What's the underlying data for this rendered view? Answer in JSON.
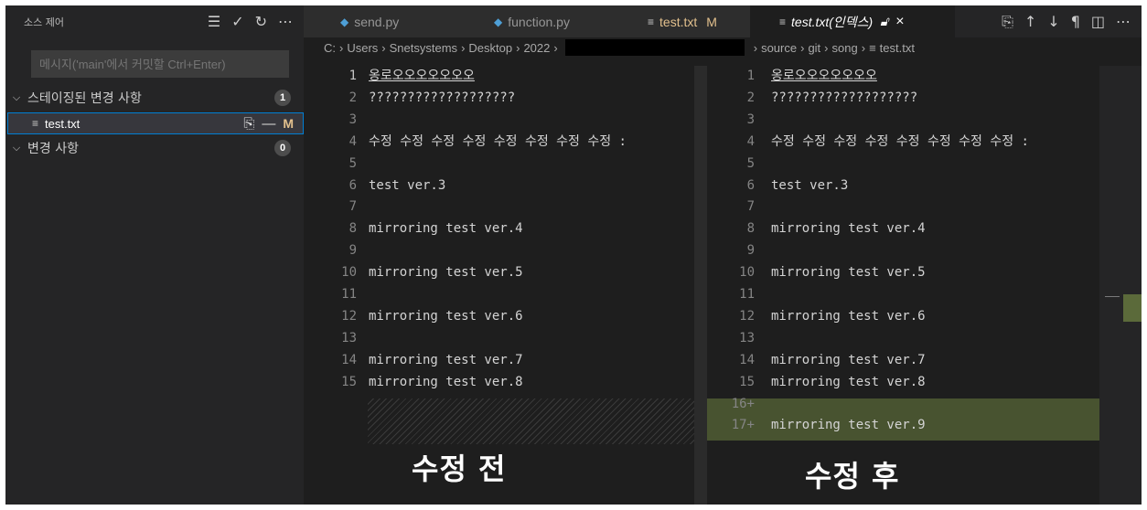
{
  "sidebar": {
    "title": "소스 제어",
    "actions": [
      "☰",
      "✓",
      "↻",
      "⋯"
    ],
    "commit_placeholder": "메시지('main'에서 커밋할 Ctrl+Enter)",
    "staged_group": {
      "label": "스테이징된 변경 사항",
      "count": "1"
    },
    "staged_file": {
      "name": "test.txt",
      "status": "M"
    },
    "changes_group": {
      "label": "변경 사항",
      "count": "0"
    }
  },
  "tabs": [
    {
      "label": "send.py",
      "icon": "python-icon"
    },
    {
      "label": "function.py",
      "icon": "python-icon"
    },
    {
      "label": "test.txt",
      "mark": "M",
      "icon": "file-text-icon"
    },
    {
      "label": "test.txt(인덱스)",
      "icon": "file-text-icon",
      "active": true
    }
  ],
  "breadcrumb": {
    "left": [
      "C:",
      "Users",
      "Snetsystems",
      "Desktop",
      "2022"
    ],
    "right": [
      "source",
      "git",
      "song",
      "test.txt"
    ]
  },
  "left_pane": {
    "lines": [
      {
        "n": "1",
        "text": "옹로오오오오오오오"
      },
      {
        "n": "2",
        "text": "???????????????????"
      },
      {
        "n": "3",
        "text": ""
      },
      {
        "n": "4",
        "text": "수정 수정 수정 수정 수정 수정 수정 수정 :"
      },
      {
        "n": "5",
        "text": ""
      },
      {
        "n": "6",
        "text": "test ver.3"
      },
      {
        "n": "7",
        "text": ""
      },
      {
        "n": "8",
        "text": "mirroring test ver.4"
      },
      {
        "n": "9",
        "text": ""
      },
      {
        "n": "10",
        "text": "mirroring test ver.5"
      },
      {
        "n": "11",
        "text": ""
      },
      {
        "n": "12",
        "text": "mirroring test ver.6"
      },
      {
        "n": "13",
        "text": ""
      },
      {
        "n": "14",
        "text": "mirroring test ver.7"
      },
      {
        "n": "15",
        "text": "mirroring test ver.8"
      }
    ]
  },
  "right_pane": {
    "lines": [
      {
        "n": "1",
        "text": "옹로오오오오오오오"
      },
      {
        "n": "2",
        "text": "???????????????????"
      },
      {
        "n": "3",
        "text": ""
      },
      {
        "n": "4",
        "text": "수정 수정 수정 수정 수정 수정 수정 수정 :"
      },
      {
        "n": "5",
        "text": ""
      },
      {
        "n": "6",
        "text": "test ver.3"
      },
      {
        "n": "7",
        "text": ""
      },
      {
        "n": "8",
        "text": "mirroring test ver.4"
      },
      {
        "n": "9",
        "text": ""
      },
      {
        "n": "10",
        "text": "mirroring test ver.5"
      },
      {
        "n": "11",
        "text": ""
      },
      {
        "n": "12",
        "text": "mirroring test ver.6"
      },
      {
        "n": "13",
        "text": ""
      },
      {
        "n": "14",
        "text": "mirroring test ver.7"
      },
      {
        "n": "15",
        "text": "mirroring test ver.8"
      },
      {
        "n": "16+",
        "text": ""
      },
      {
        "n": "17+",
        "text": "mirroring test ver.9"
      }
    ]
  },
  "captions": {
    "before": "수정 전",
    "after": "수정 후"
  },
  "colors": {
    "accent": "#007fd4",
    "modified": "#e2c08d",
    "added_bg": "#4b5632"
  }
}
